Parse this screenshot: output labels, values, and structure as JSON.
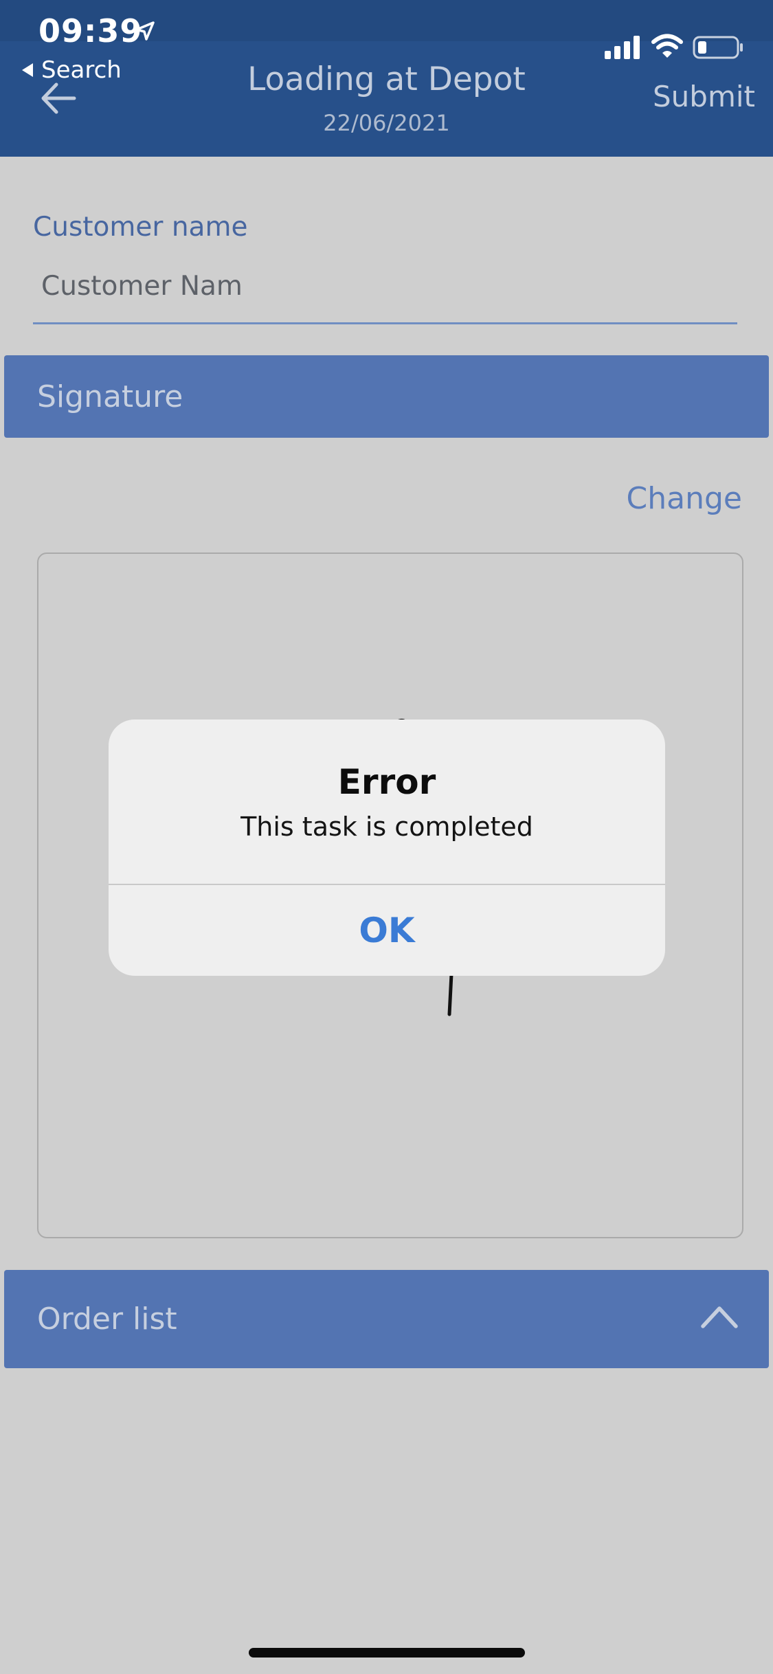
{
  "status_bar": {
    "time": "09:39",
    "back_app_label": "Search"
  },
  "header": {
    "title": "Loading at Depot",
    "date": "22/06/2021",
    "submit_label": "Submit",
    "background_color": "#27508a"
  },
  "form": {
    "customer_name_label": "Customer name",
    "customer_name_value": "Customer Nam"
  },
  "signature_section": {
    "title": "Signature",
    "change_label": "Change"
  },
  "order_section": {
    "title": "Order list"
  },
  "alert": {
    "title": "Error",
    "message": "This task is completed",
    "ok_label": "OK",
    "ok_color": "#3a7bd5"
  },
  "icons": [
    "location-arrow-icon",
    "signal-icon",
    "wifi-icon",
    "battery-icon",
    "back-arrow-icon",
    "chevron-up-icon"
  ]
}
